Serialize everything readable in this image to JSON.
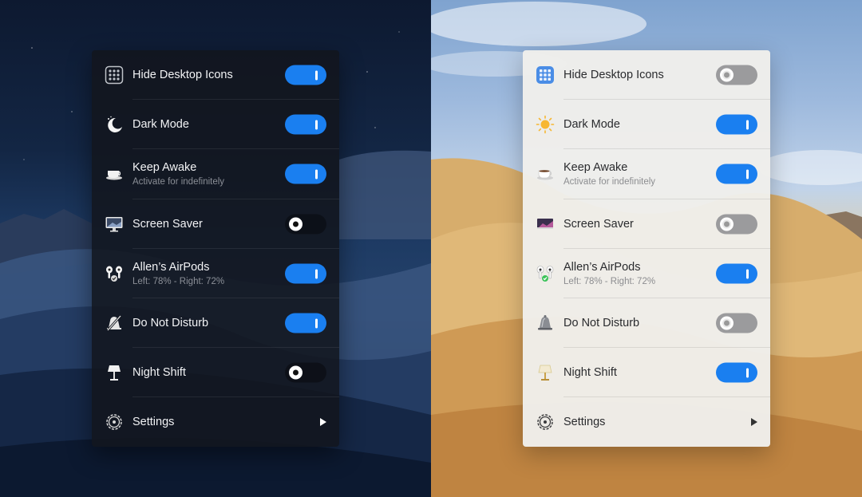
{
  "dark_panel": {
    "items": [
      {
        "label": "Hide Desktop Icons",
        "icon": "grid-icon",
        "toggle": "on"
      },
      {
        "label": "Dark Mode",
        "icon": "moon-icon",
        "toggle": "on"
      },
      {
        "label": "Keep Awake",
        "sublabel": "Activate for indefinitely",
        "icon": "coffee-cup-icon",
        "toggle": "on"
      },
      {
        "label": "Screen Saver",
        "icon": "monitor-icon",
        "toggle": "off"
      },
      {
        "label": "Allen’s AirPods",
        "sublabel": "Left: 78% - Right: 72%",
        "icon": "airpods-icon",
        "toggle": "on"
      },
      {
        "label": "Do Not Disturb",
        "icon": "bell-slash-icon",
        "toggle": "on"
      },
      {
        "label": "Night Shift",
        "icon": "lamp-icon",
        "toggle": "off"
      },
      {
        "label": "Settings",
        "icon": "gear-icon",
        "control": "arrow"
      }
    ]
  },
  "light_panel": {
    "items": [
      {
        "label": "Hide Desktop Icons",
        "icon": "grid-icon",
        "toggle": "off"
      },
      {
        "label": "Dark Mode",
        "icon": "sun-icon",
        "toggle": "on"
      },
      {
        "label": "Keep Awake",
        "sublabel": "Activate for indefinitely",
        "icon": "coffee-cup-icon",
        "toggle": "on"
      },
      {
        "label": "Screen Saver",
        "icon": "monitor-icon",
        "toggle": "off"
      },
      {
        "label": "Allen’s AirPods",
        "sublabel": "Left: 78% - Right: 72%",
        "icon": "airpods-icon",
        "toggle": "on"
      },
      {
        "label": "Do Not Disturb",
        "icon": "bell-icon",
        "toggle": "off"
      },
      {
        "label": "Night Shift",
        "icon": "lamp-icon",
        "toggle": "on"
      },
      {
        "label": "Settings",
        "icon": "gear-icon",
        "control": "arrow"
      }
    ]
  },
  "colors": {
    "toggle_on": "#1a7ff0",
    "dark_panel_bg": "#12161e",
    "light_panel_bg": "#f0eeeb"
  }
}
